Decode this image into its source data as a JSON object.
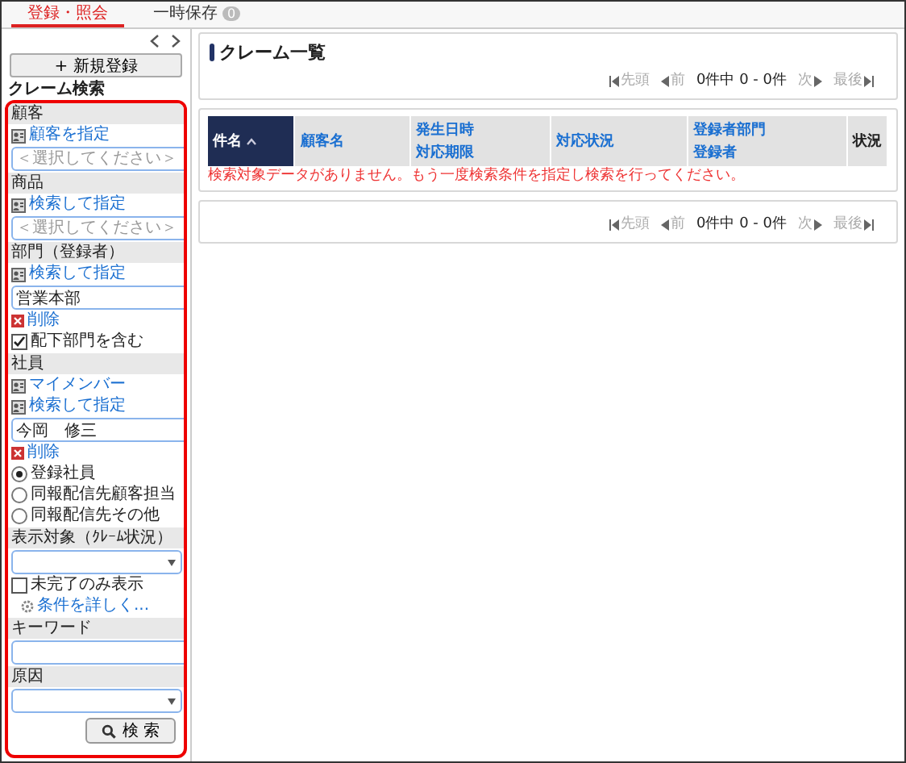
{
  "tabs": [
    {
      "label": "登録・照会",
      "selected": true
    },
    {
      "label": "一時保存",
      "badge": "0",
      "selected": false
    }
  ],
  "new_button": "+ 新規登録",
  "search_title": "クレーム検索",
  "sections": [
    {
      "heading": "顧客",
      "items": [
        {
          "kind": "link",
          "text": "顧客を指定"
        },
        {
          "kind": "field",
          "placeholder": "＜選択してください＞"
        }
      ]
    },
    {
      "heading": "商品",
      "items": [
        {
          "kind": "link",
          "text": "検索して指定"
        },
        {
          "kind": "field",
          "placeholder": "＜選択してください＞"
        }
      ]
    },
    {
      "heading": "部門（登録者）",
      "items": [
        {
          "kind": "link",
          "text": "検索して指定"
        },
        {
          "kind": "field",
          "value": "営業本部"
        },
        {
          "kind": "delete",
          "text": "削除"
        },
        {
          "kind": "checkbox",
          "text": "配下部門を含む",
          "checked": true
        }
      ]
    },
    {
      "heading": "社員",
      "items": [
        {
          "kind": "link",
          "text": "マイメンバー"
        },
        {
          "kind": "link",
          "text": "検索して指定"
        },
        {
          "kind": "field",
          "value": "今岡　修三"
        },
        {
          "kind": "delete",
          "text": "削除"
        },
        {
          "kind": "radio",
          "text": "登録社員",
          "selected": true
        },
        {
          "kind": "radio",
          "text": "同報配信先顧客担当",
          "selected": false
        },
        {
          "kind": "radio",
          "text": "同報配信先その他",
          "selected": false
        }
      ]
    },
    {
      "heading": "表示対象（ｸﾚｰﾑ状況）",
      "items": [
        {
          "kind": "select"
        },
        {
          "kind": "checkbox",
          "text": "未完了のみ表示",
          "checked": false
        },
        {
          "kind": "more",
          "text": "条件を詳しく..."
        }
      ]
    },
    {
      "heading": "キーワード",
      "items": [
        {
          "kind": "field"
        }
      ]
    },
    {
      "heading": "原因",
      "items": [
        {
          "kind": "select"
        },
        {
          "kind": "button",
          "text": "検 索"
        }
      ]
    }
  ],
  "list_title": "クレーム一覧",
  "pagers": [
    {
      "first": "先頭",
      "prev": "前",
      "info": "0件中 0 - 0件",
      "next": "次",
      "last": "最後"
    },
    {
      "first": "先頭",
      "prev": "前",
      "info": "0件中 0 - 0件",
      "next": "次",
      "last": "最後"
    }
  ],
  "columns": [
    {
      "kind": "link",
      "lines": [
        "件名"
      ],
      "sorted": true
    },
    {
      "kind": "link",
      "lines": [
        "顧客名"
      ],
      "sorted": false
    },
    {
      "kind": "link",
      "lines": [
        "発生日時",
        "対応期限"
      ],
      "sorted": false
    },
    {
      "kind": "link",
      "lines": [
        "対応状況"
      ],
      "sorted": false
    },
    {
      "kind": "link",
      "lines": [
        "登録者部門",
        "登録者"
      ],
      "sorted": false
    },
    {
      "kind": "plain",
      "lines": [
        "状況"
      ]
    }
  ],
  "empty_message": "検索対象データがありません。もう一度検索条件を指定し検索を行ってください。"
}
